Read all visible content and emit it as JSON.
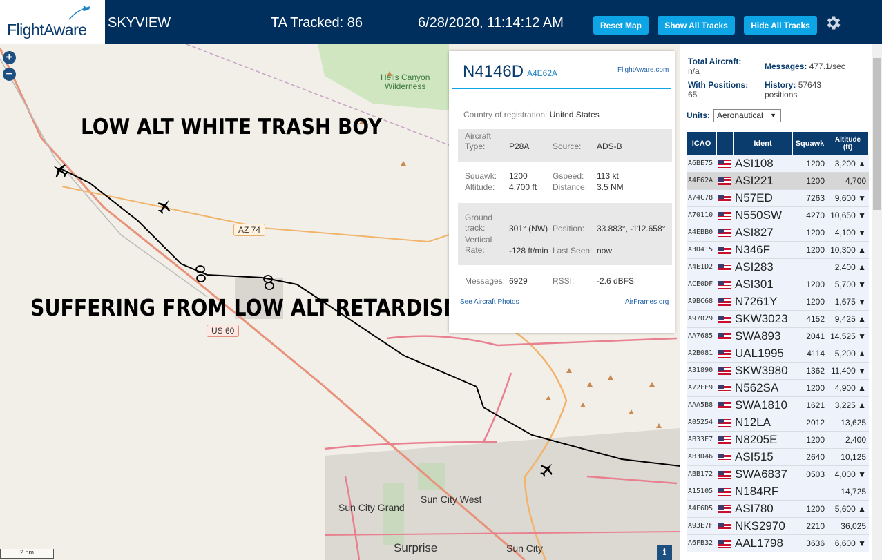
{
  "header": {
    "logo_text": "FlightAware",
    "app_title": "SKYVIEW",
    "tracked": "TA Tracked: 86",
    "clock": "6/28/2020, 11:14:12 AM",
    "btn_reset": "Reset Map",
    "btn_show": "Show All Tracks",
    "btn_hide": "Hide All Tracks"
  },
  "map": {
    "zoom_in": "+",
    "zoom_out": "−",
    "overlay_1": "LOW ALT WHITE TRASH BOY",
    "overlay_2": "SUFFERING FROM LOW ALT RETARDISM",
    "labels": {
      "hells_canyon": "Hells Canyon\nWilderness",
      "az74": "AZ 74",
      "us60": "US 60",
      "sun_city_west": "Sun City West",
      "sun_city_grand": "Sun City Grand",
      "surprise": "Surprise",
      "sun_city": "Sun City"
    },
    "scale": "2 nm",
    "info": "i"
  },
  "detail": {
    "registration": "N4146D",
    "hex": "A4E62A",
    "fa_link": "FlightAware.com",
    "country_label": "Country of registration:",
    "country": "United States",
    "aircraft_type_label": "Aircraft\nType:",
    "aircraft_type": "P28A",
    "source_label": "Source:",
    "source": "ADS-B",
    "squawk_label": "Squawk:",
    "squawk": "1200",
    "altitude_label": "Altitude:",
    "altitude": "4,700 ft",
    "gspeed_label": "Gspeed:",
    "gspeed": "113 kt",
    "distance_label": "Distance:",
    "distance": "3.5 NM",
    "track_label": "Ground\ntrack:",
    "track": "301° (NW)",
    "position_label": "Position:",
    "position": "33.883°, -112.658°",
    "vrate_label": "Vertical\nRate:",
    "vrate": "-128 ft/min",
    "lastseen_label": "Last Seen:",
    "lastseen": "now",
    "messages_label": "Messages:",
    "messages": "6929",
    "rssi_label": "RSSI:",
    "rssi": "-2.6 dBFS",
    "photos_link": "See Aircraft Photos",
    "airframes_link": "AirFrames.org"
  },
  "sidebar": {
    "total_label": "Total Aircraft:",
    "total_value": "n/a",
    "messages_label": "Messages:",
    "messages_value": "477.1/sec",
    "positions_label": "With Positions:",
    "positions_value": "65",
    "history_label": "History:",
    "history_value": "57643",
    "history_unit": "positions",
    "units_label": "Units:",
    "units_value": "Aeronautical",
    "columns": [
      "ICAO",
      "Ident",
      "Squawk",
      "Altitude\n(ft)"
    ],
    "rows": [
      {
        "icao": "A6BE75",
        "ident": "ASI108",
        "squawk": "1200",
        "alt": "3,200 ▲"
      },
      {
        "icao": "A4E62A",
        "ident": "ASI221",
        "squawk": "1200",
        "alt": "4,700"
      },
      {
        "icao": "A74C78",
        "ident": "N57ED",
        "squawk": "7263",
        "alt": "9,600 ▼"
      },
      {
        "icao": "A70110",
        "ident": "N550SW",
        "squawk": "4270",
        "alt": "10,650 ▼"
      },
      {
        "icao": "A4EBB0",
        "ident": "ASI827",
        "squawk": "1200",
        "alt": "4,100 ▼"
      },
      {
        "icao": "A3D415",
        "ident": "N346F",
        "squawk": "1200",
        "alt": "10,300 ▲"
      },
      {
        "icao": "A4E1D2",
        "ident": "ASI283",
        "squawk": "",
        "alt": "2,400 ▲"
      },
      {
        "icao": "ACE0DF",
        "ident": "ASI301",
        "squawk": "1200",
        "alt": "5,700 ▼"
      },
      {
        "icao": "A9BC68",
        "ident": "N7261Y",
        "squawk": "1200",
        "alt": "1,675 ▼"
      },
      {
        "icao": "A97029",
        "ident": "SKW3023",
        "squawk": "4152",
        "alt": "9,425 ▲"
      },
      {
        "icao": "AA7685",
        "ident": "SWA893",
        "squawk": "2041",
        "alt": "14,525 ▼"
      },
      {
        "icao": "A2B081",
        "ident": "UAL1995",
        "squawk": "4114",
        "alt": "5,200 ▲"
      },
      {
        "icao": "A31890",
        "ident": "SKW3980",
        "squawk": "1362",
        "alt": "11,400 ▼"
      },
      {
        "icao": "A72FE9",
        "ident": "N562SA",
        "squawk": "1200",
        "alt": "4,900 ▲"
      },
      {
        "icao": "AAA5B8",
        "ident": "SWA1810",
        "squawk": "1621",
        "alt": "3,225 ▲"
      },
      {
        "icao": "A05254",
        "ident": "N12LA",
        "squawk": "2012",
        "alt": "13,625"
      },
      {
        "icao": "AB33E7",
        "ident": "N8205E",
        "squawk": "1200",
        "alt": "2,400"
      },
      {
        "icao": "AB3D46",
        "ident": "ASI515",
        "squawk": "2640",
        "alt": "10,125"
      },
      {
        "icao": "ABB172",
        "ident": "SWA6837",
        "squawk": "0503",
        "alt": "4,000 ▼"
      },
      {
        "icao": "A15105",
        "ident": "N184RF",
        "squawk": "",
        "alt": "14,725"
      },
      {
        "icao": "A4F6D5",
        "ident": "ASI780",
        "squawk": "1200",
        "alt": "5,600 ▲"
      },
      {
        "icao": "A93E7F",
        "ident": "NKS2970",
        "squawk": "2210",
        "alt": "36,025"
      },
      {
        "icao": "A6FB32",
        "ident": "AAL1798",
        "squawk": "3636",
        "alt": "6,600 ▼"
      }
    ]
  },
  "colors": {
    "header_bg": "#002f5d",
    "button": "#0ea5e6",
    "accent_navy": "#0a3c6e"
  }
}
